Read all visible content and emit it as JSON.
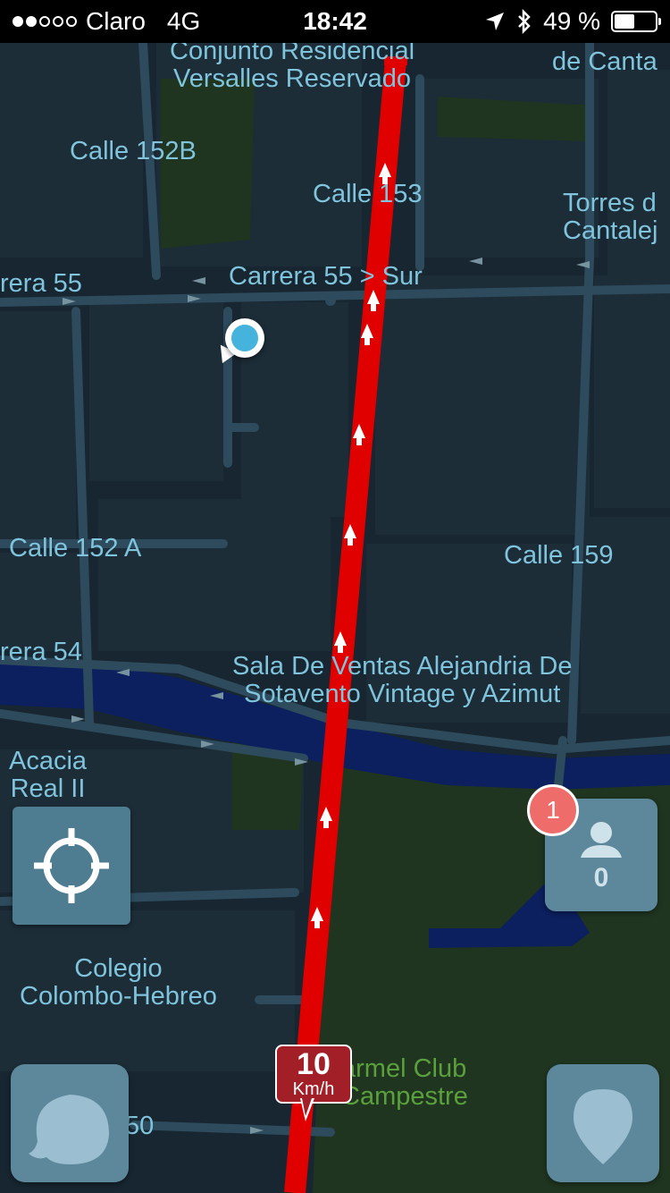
{
  "status_bar": {
    "carrier": "Claro",
    "network": "4G",
    "time": "18:42",
    "battery": "49 %",
    "battery_level": 0.49
  },
  "map": {
    "labels": {
      "conjunto": "Conjunto Residencial\nVersalles Reservado",
      "de_canta": "de Canta",
      "calle_152b": "Calle 152B",
      "calle_153": "Calle 153",
      "torres": "Torres d\nCantalej",
      "carrera_55_left": "rera 55",
      "carrera_55_sur": "Carrera 55 > Sur",
      "calle_152a": "Calle 152 A",
      "calle_159": "Calle 159",
      "carrera_54": "rera 54",
      "sala_ventas": "Sala De Ventas Alejandria De\nSotavento Vintage y Azimut",
      "acacia": "Acacia\nReal II",
      "colegio": "Colegio\nColombo-Hebreo",
      "carmel": "armel Club\nCampestre",
      "bottom_street": "50"
    },
    "colors": {
      "background": "#172630",
      "road": "#2d4b5c",
      "block": "#1c2d38",
      "traffic_jam": "#e00000",
      "river": "#0c1f5e",
      "park": "#1f3520"
    }
  },
  "controls": {
    "recenter_icon": "crosshair-icon",
    "users_count": "0",
    "notification_count": "1",
    "menu_icon": "waze-bubble-icon",
    "report_icon": "pin-icon"
  },
  "speed": {
    "value": "10",
    "unit": "Km/h"
  }
}
